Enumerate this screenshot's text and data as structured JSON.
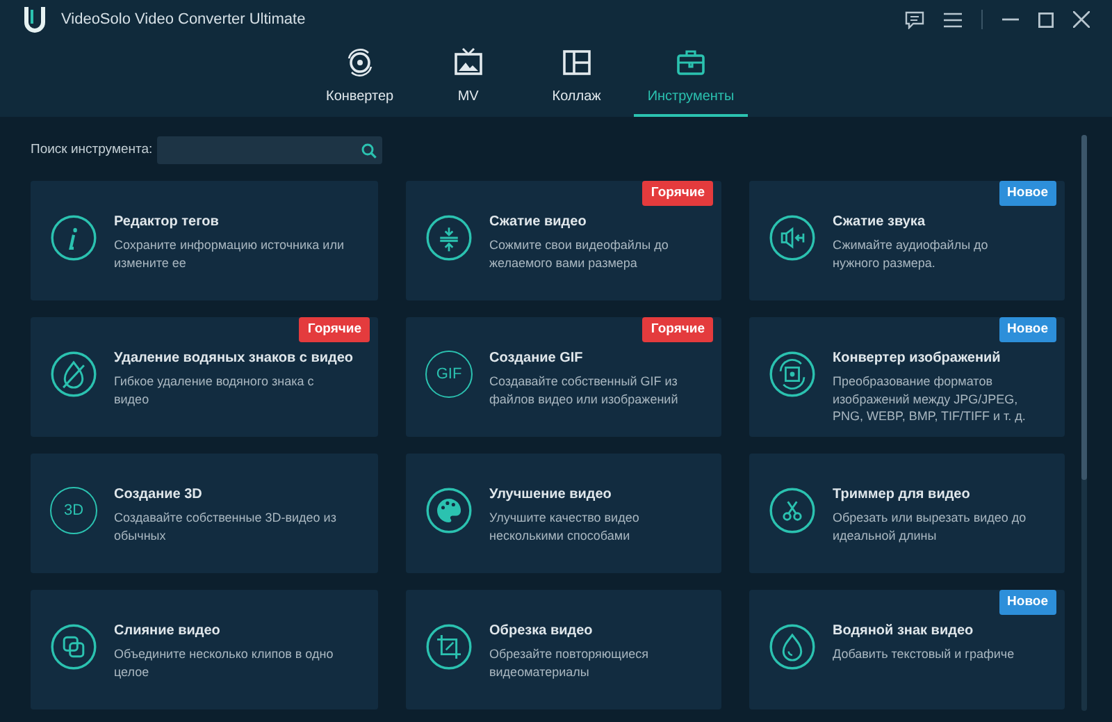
{
  "window": {
    "title": "VideoSolo Video Converter Ultimate"
  },
  "tabs": [
    {
      "label": "Конвертер",
      "selected": false
    },
    {
      "label": "MV",
      "selected": false
    },
    {
      "label": "Коллаж",
      "selected": false
    },
    {
      "label": "Инструменты",
      "selected": true
    }
  ],
  "search": {
    "label": "Поиск инструмента:"
  },
  "tools": [
    {
      "title": "Редактор тегов",
      "description": "Сохраните информацию источника или измените ее"
    },
    {
      "title": "Сжатие видео",
      "description": "Сожмите свои видеофайлы до желаемого вами размера",
      "badge": {
        "text": "Горячие",
        "kind": "hot"
      }
    },
    {
      "title": "Сжатие звука",
      "description": "Сжимайте аудиофайлы до нужного размера.",
      "badge": {
        "text": "Новое",
        "kind": "new"
      }
    },
    {
      "title": "Удаление водяных знаков с видео",
      "description": "Гибкое удаление водяного знака с видео",
      "badge": {
        "text": "Горячие",
        "kind": "hot"
      }
    },
    {
      "title": "Создание GIF",
      "description": "Создавайте собственный GIF из файлов видео или изображений",
      "icon_text": "GIF",
      "badge": {
        "text": "Горячие",
        "kind": "hot"
      }
    },
    {
      "title": "Конвертер изображений",
      "description": "Преобразование форматов изображений между JPG/JPEG, PNG, WEBP, BMP, TIF/TIFF и т. д.",
      "badge": {
        "text": "Новое",
        "kind": "new"
      }
    },
    {
      "title": "Создание 3D",
      "description": "Создавайте собственные 3D-видео из обычных",
      "icon_text": "3D"
    },
    {
      "title": "Улучшение видео",
      "description": "Улучшите качество видео несколькими способами"
    },
    {
      "title": "Триммер для видео",
      "description": "Обрезать или вырезать видео до идеальной длины"
    },
    {
      "title": "Слияние видео",
      "description": "Объедините несколько клипов в одно целое"
    },
    {
      "title": "Обрезка видео",
      "description": "Обрезайте повторяющиеся видеоматериалы"
    },
    {
      "title": "Водяной знак видео",
      "description": "Добавить текстовый и графиче",
      "badge": {
        "text": "Новое",
        "kind": "new"
      }
    }
  ]
}
